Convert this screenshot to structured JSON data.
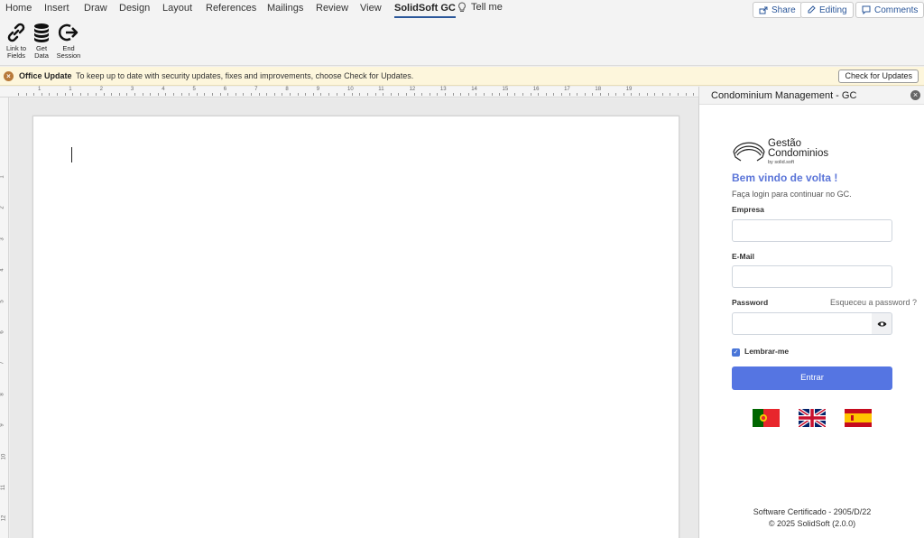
{
  "ribbon": {
    "tabs": [
      {
        "label": "Home"
      },
      {
        "label": "Insert"
      },
      {
        "label": "Draw"
      },
      {
        "label": "Design"
      },
      {
        "label": "Layout"
      },
      {
        "label": "References"
      },
      {
        "label": "Mailings"
      },
      {
        "label": "Review"
      },
      {
        "label": "View"
      },
      {
        "label": "SolidSoft GC",
        "active": true
      }
    ],
    "tell_me": "Tell me",
    "share": "Share",
    "editing": "Editing",
    "comments": "Comments",
    "buttons": [
      {
        "label_line1": "Link to",
        "label_line2": "Fields",
        "icon": "link-icon"
      },
      {
        "label_line1": "Get",
        "label_line2": "Data",
        "icon": "database-icon"
      },
      {
        "label_line1": "End",
        "label_line2": "Session",
        "icon": "logout-icon"
      }
    ]
  },
  "message_bar": {
    "title": "Office Update",
    "text": "To keep up to date with security updates, fixes and improvements, choose Check for Updates.",
    "button": "Check for Updates"
  },
  "ruler": {
    "numbers": [
      "1",
      "1",
      "2",
      "3",
      "4",
      "5",
      "6",
      "7",
      "8",
      "9",
      "10",
      "11",
      "12",
      "13",
      "14",
      "15",
      "16",
      "17",
      "18",
      "19"
    ],
    "vertical_numbers": [
      "1",
      "2",
      "3",
      "4",
      "5",
      "6",
      "7",
      "8",
      "9",
      "10",
      "11",
      "12"
    ]
  },
  "panel": {
    "title": "Condominium Management - GC",
    "logo": {
      "line1": "Gestão",
      "line2": "Condominios",
      "line3": "by solid.soft"
    },
    "welcome": "Bem vindo de volta !",
    "subtitle": "Faça login para continuar no GC.",
    "company_label": "Empresa",
    "company_value": "",
    "email_label": "E-Mail",
    "email_value": "",
    "password_label": "Password",
    "password_value": "",
    "forgot": "Esqueceu a password ?",
    "remember": "Lembrar-me",
    "remember_checked": true,
    "login_button": "Entrar",
    "languages": [
      "portugal-flag",
      "uk-flag",
      "spain-flag"
    ],
    "footer_line1": "Software Certificado - 2905/D/22",
    "footer_line2": "© 2025 SolidSoft (2.0.0)"
  },
  "colors": {
    "accent": "#5575e2",
    "welcome_text": "#5b75d8",
    "word_blue": "#2b579a",
    "message_bar": "#fdf6dc"
  }
}
